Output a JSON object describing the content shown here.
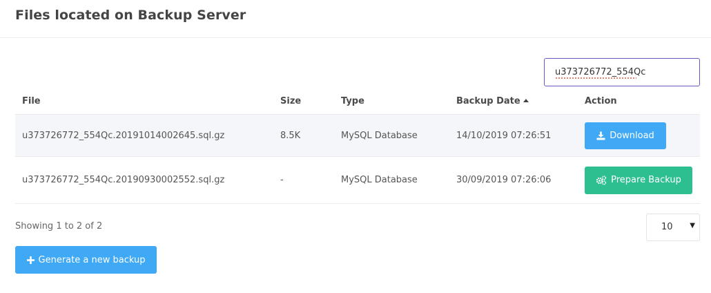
{
  "header": {
    "title": "Files located on Backup Server"
  },
  "search": {
    "value": "u373726772_554Qc"
  },
  "table": {
    "columns": [
      "File",
      "Size",
      "Type",
      "Backup Date",
      "Action"
    ],
    "rows": [
      {
        "file": "u373726772_554Qc.20191014002645.sql.gz",
        "size": "8.5K",
        "type": "MySQL Database",
        "date": "14/10/2019 07:26:51",
        "action": "Download"
      },
      {
        "file": "u373726772_554Qc.20190930002552.sql.gz",
        "size": "-",
        "type": "MySQL Database",
        "date": "30/09/2019 07:26:06",
        "action": "Prepare Backup"
      }
    ]
  },
  "footer": {
    "showing": "Showing 1 to 2 of 2",
    "page_size": "10",
    "generate_label": "Generate a new backup"
  },
  "colors": {
    "download_button": "#3fa9f5",
    "prepare_button": "#2ebf91",
    "generate_button": "#3fa9f5",
    "search_focus_border": "#6b57c9"
  },
  "icons": {
    "download": "download-icon",
    "prepare": "gears-icon",
    "generate": "plus-icon",
    "sort": "sort-ascending-icon",
    "select": "caret-down-icon"
  }
}
